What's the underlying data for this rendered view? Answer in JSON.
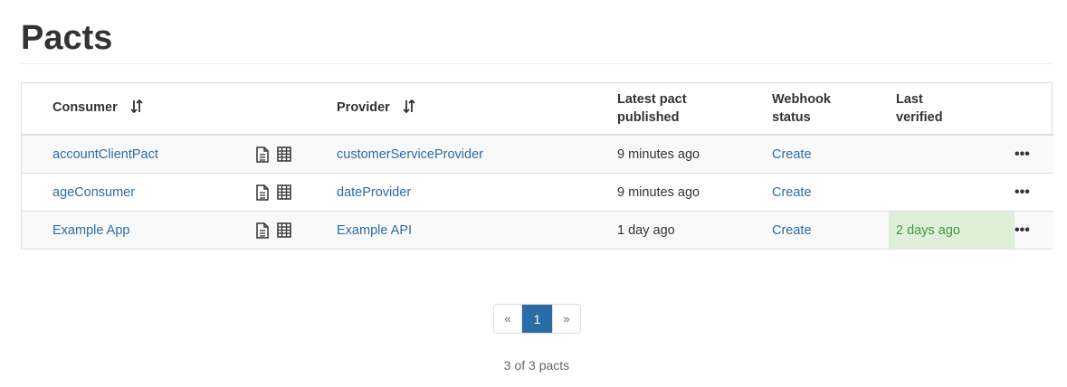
{
  "page": {
    "title": "Pacts"
  },
  "table": {
    "headers": {
      "consumer": "Consumer",
      "provider": "Provider",
      "latest_line1": "Latest pact",
      "latest_line2": "published",
      "webhook_line1": "Webhook",
      "webhook_line2": "status",
      "verified_line1": "Last",
      "verified_line2": "verified"
    },
    "rows": [
      {
        "consumer": "accountClientPact",
        "provider": "customerServiceProvider",
        "published": "9 minutes ago",
        "webhook": "Create",
        "verified": "",
        "menu": "•••"
      },
      {
        "consumer": "ageConsumer",
        "provider": "dateProvider",
        "published": "9 minutes ago",
        "webhook": "Create",
        "verified": "",
        "menu": "•••"
      },
      {
        "consumer": "Example App",
        "provider": "Example API",
        "published": "1 day ago",
        "webhook": "Create",
        "verified": "2 days ago",
        "menu": "•••"
      }
    ]
  },
  "icons": {
    "sort": "sort-arrows-icon",
    "document": "document-icon",
    "matrix": "grid-matrix-icon",
    "menu": "ellipsis-icon"
  },
  "pagination": {
    "prev": "«",
    "current": "1",
    "next": "»"
  },
  "footer": {
    "count": "3 of 3 pacts"
  },
  "colors": {
    "link": "#2a6ca8",
    "success_bg": "#dff0d8",
    "success_text": "#3c9a3c",
    "active_page": "#2a6ca8"
  }
}
